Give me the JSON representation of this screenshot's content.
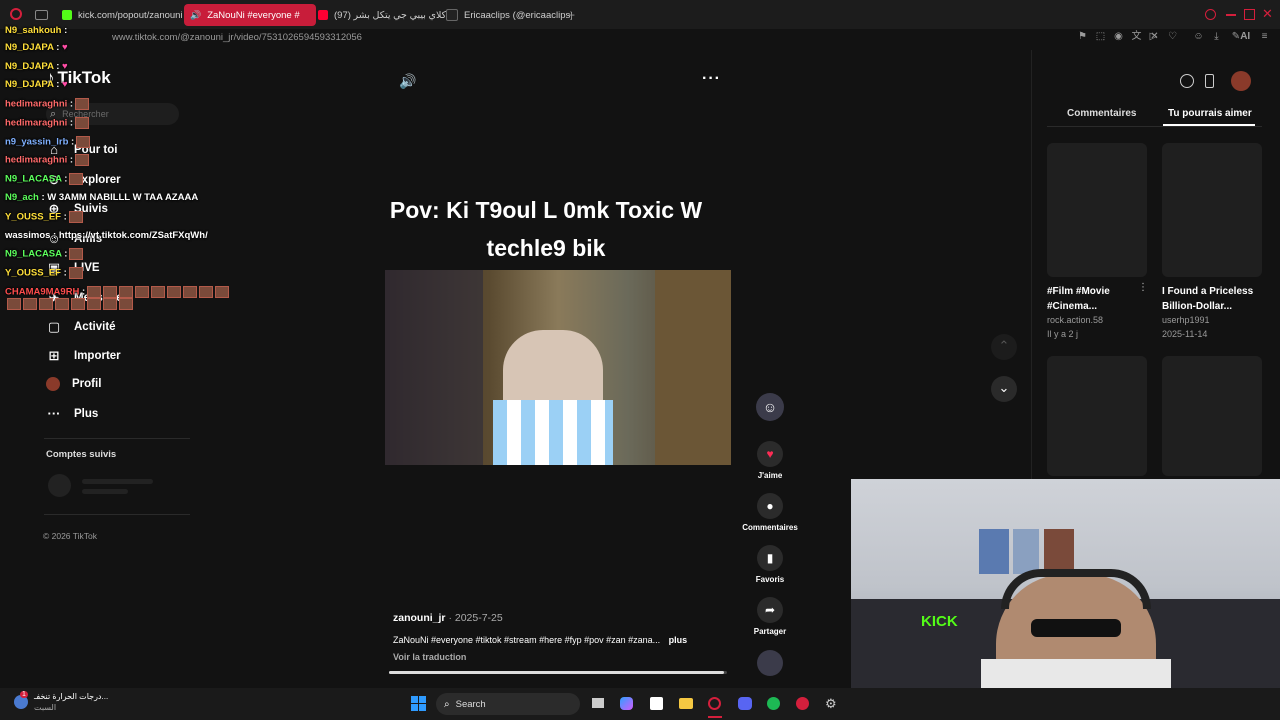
{
  "browser": {
    "tabs": [
      {
        "label": "kick.com/popout/zanouni",
        "color": "#53fc18"
      },
      {
        "label": "ZaNouNi #everyone #",
        "color": "#ffffff",
        "active": true
      },
      {
        "label": "(97) كلاي بيبي جي يتكل بشر",
        "color": "#ff0033"
      },
      {
        "label": "Ericaaclips (@ericaaclips)",
        "color": "#ffffff"
      }
    ],
    "new_tab": "+",
    "url": "www.tiktok.com/@zanouni_jr/video/7531026594593312056",
    "ai_label": "AI"
  },
  "chat": [
    {
      "name": "N9_sahkouh",
      "msg": ""
    },
    {
      "name": "N9_DJAPA",
      "msg": ""
    },
    {
      "name": "N9_DJAPA",
      "msg": ""
    },
    {
      "name": "N9_DJAPA",
      "msg": ""
    },
    {
      "name": "hedimaraghni",
      "msg": ""
    },
    {
      "name": "hedimaraghni",
      "msg": ""
    },
    {
      "name": "n9_yassin_lrb",
      "msg": ""
    },
    {
      "name": "hedimaraghni",
      "msg": ""
    },
    {
      "name": "N9_LACASA",
      "msg": ""
    },
    {
      "name": "N9_ach",
      "msg": "W 3AMM NABILLL W TAA AZAAA"
    },
    {
      "name": "Y_OUSS_EF",
      "msg": ""
    },
    {
      "name": "wassimos",
      "msg": "https://vt.tiktok.com/ZSatFXqWh/"
    },
    {
      "name": "N9_LACASA",
      "msg": ""
    },
    {
      "name": "Y_OUSS_EF",
      "msg": ""
    },
    {
      "name": "CHAMA9MA9RH",
      "msg": ""
    }
  ],
  "tiktok": {
    "logo": "TikTok",
    "search_placeholder": "Rechercher",
    "nav": {
      "for_you": "Pour toi",
      "explore": "Explorer",
      "following": "Suivis",
      "friends": "Amis",
      "live": "LIVE",
      "messages": "Messages",
      "activity": "Activité",
      "upload": "Importer",
      "profile": "Profil",
      "more": "Plus"
    },
    "following_accounts": "Comptes suivis",
    "footer": "© 2026 TikTok"
  },
  "video": {
    "caption_line1": "Pov: Ki T9oul L 0mk Toxic W",
    "caption_line2": "techle9 bik",
    "author": "zanouni_jr",
    "date": "2025-7-25",
    "description": "ZaNouNi #everyone #tiktok #stream #here #fyp #pov #zan #zana...",
    "more": "plus",
    "translate": "Voir la traduction",
    "progress": 0.99
  },
  "actions": {
    "like": "J'aime",
    "comments": "Commentaires",
    "favorites": "Favoris",
    "share": "Partager"
  },
  "right_panel": {
    "tab_comments": "Commentaires",
    "tab_might_like": "Tu pourrais aimer",
    "cards": [
      {
        "title": "#Film #Movie #Cinema...",
        "user": "rock.action.58",
        "date": "Il y a 2 j"
      },
      {
        "title": "I Found a Priceless Billion-Dollar...",
        "user": "userhp1991",
        "date": "2025-11-14"
      }
    ]
  },
  "webcam": {
    "sign": "KICK"
  },
  "taskbar": {
    "weather_line1": "درجات الحرارة تنخفـ...",
    "weather_line2": "السبت",
    "search": "Search",
    "notification_badge": "1"
  },
  "colors": {
    "accent": "#fe2c55",
    "tab_active": "#c81d3a",
    "chat_name": "#ffdf3a"
  }
}
